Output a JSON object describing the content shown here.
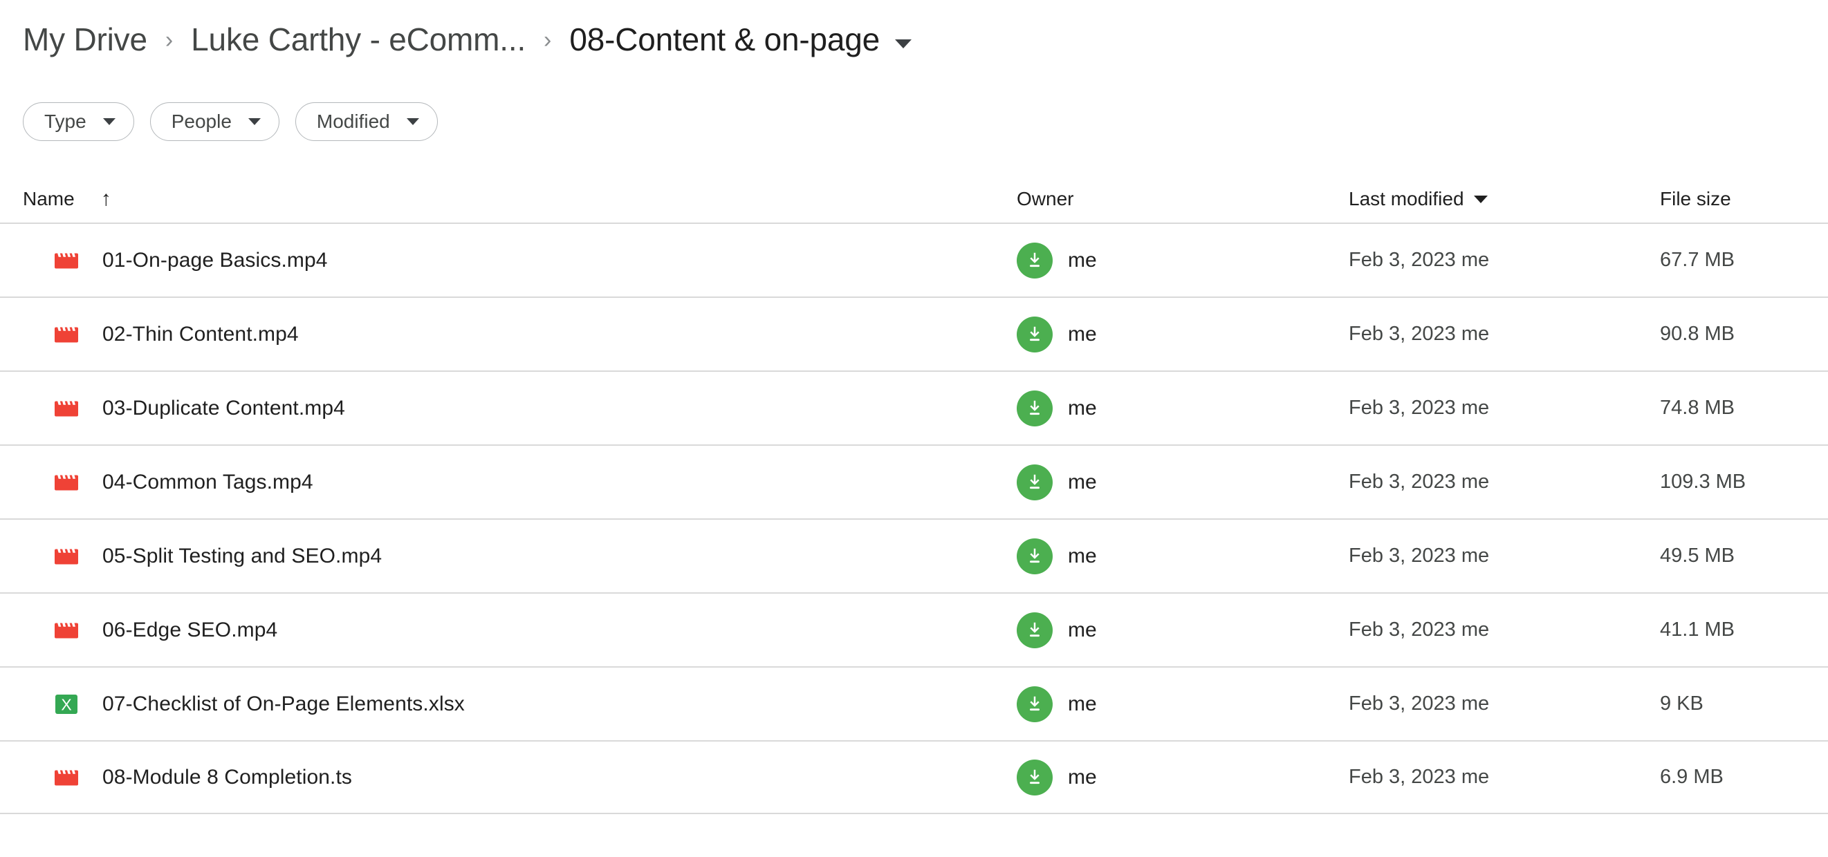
{
  "breadcrumb": {
    "items": [
      {
        "label": "My Drive",
        "current": false
      },
      {
        "label": "Luke Carthy - eComm...",
        "current": false
      },
      {
        "label": "08-Content & on-page",
        "current": true
      }
    ],
    "separator": "›",
    "caret_icon": "chevron-down-icon"
  },
  "filters": [
    {
      "label": "Type",
      "caret_icon": "chevron-down-icon"
    },
    {
      "label": "People",
      "caret_icon": "chevron-down-icon"
    },
    {
      "label": "Modified",
      "caret_icon": "chevron-down-icon"
    }
  ],
  "table": {
    "headers": {
      "name": "Name",
      "name_sort_icon": "arrow-up-icon",
      "name_sort_glyph": "↑",
      "owner": "Owner",
      "modified": "Last modified",
      "modified_sort_icon": "triangle-down-icon",
      "size": "File size"
    },
    "rows": [
      {
        "icon": "video-file-icon",
        "name": "01-On-page Basics.mp4",
        "owner_avatar_icon": "download-arrow-icon",
        "owner": "me",
        "modified": "Feb 3, 2023 me",
        "size": "67.7 MB"
      },
      {
        "icon": "video-file-icon",
        "name": "02-Thin Content.mp4",
        "owner_avatar_icon": "download-arrow-icon",
        "owner": "me",
        "modified": "Feb 3, 2023 me",
        "size": "90.8 MB"
      },
      {
        "icon": "video-file-icon",
        "name": "03-Duplicate Content.mp4",
        "owner_avatar_icon": "download-arrow-icon",
        "owner": "me",
        "modified": "Feb 3, 2023 me",
        "size": "74.8 MB"
      },
      {
        "icon": "video-file-icon",
        "name": "04-Common Tags.mp4",
        "owner_avatar_icon": "download-arrow-icon",
        "owner": "me",
        "modified": "Feb 3, 2023 me",
        "size": "109.3 MB"
      },
      {
        "icon": "video-file-icon",
        "name": "05-Split Testing and SEO.mp4",
        "owner_avatar_icon": "download-arrow-icon",
        "owner": "me",
        "modified": "Feb 3, 2023 me",
        "size": "49.5 MB"
      },
      {
        "icon": "video-file-icon",
        "name": "06-Edge SEO.mp4",
        "owner_avatar_icon": "download-arrow-icon",
        "owner": "me",
        "modified": "Feb 3, 2023 me",
        "size": "41.1 MB"
      },
      {
        "icon": "spreadsheet-file-icon",
        "name": "07-Checklist of On-Page Elements.xlsx",
        "owner_avatar_icon": "download-arrow-icon",
        "owner": "me",
        "modified": "Feb 3, 2023 me",
        "size": "9 KB"
      },
      {
        "icon": "video-file-icon",
        "name": "08-Module 8 Completion.ts",
        "owner_avatar_icon": "download-arrow-icon",
        "owner": "me",
        "modified": "Feb 3, 2023 me",
        "size": "6.9 MB"
      }
    ]
  },
  "colors": {
    "video_icon_red": "#EF4236",
    "spreadsheet_icon_green": "#34A853",
    "avatar_green": "#4CAF50",
    "text_primary": "#1F1F1F",
    "text_secondary": "#444746",
    "row_divider": "#D9D9D9",
    "chip_border": "#B4B8BB"
  }
}
